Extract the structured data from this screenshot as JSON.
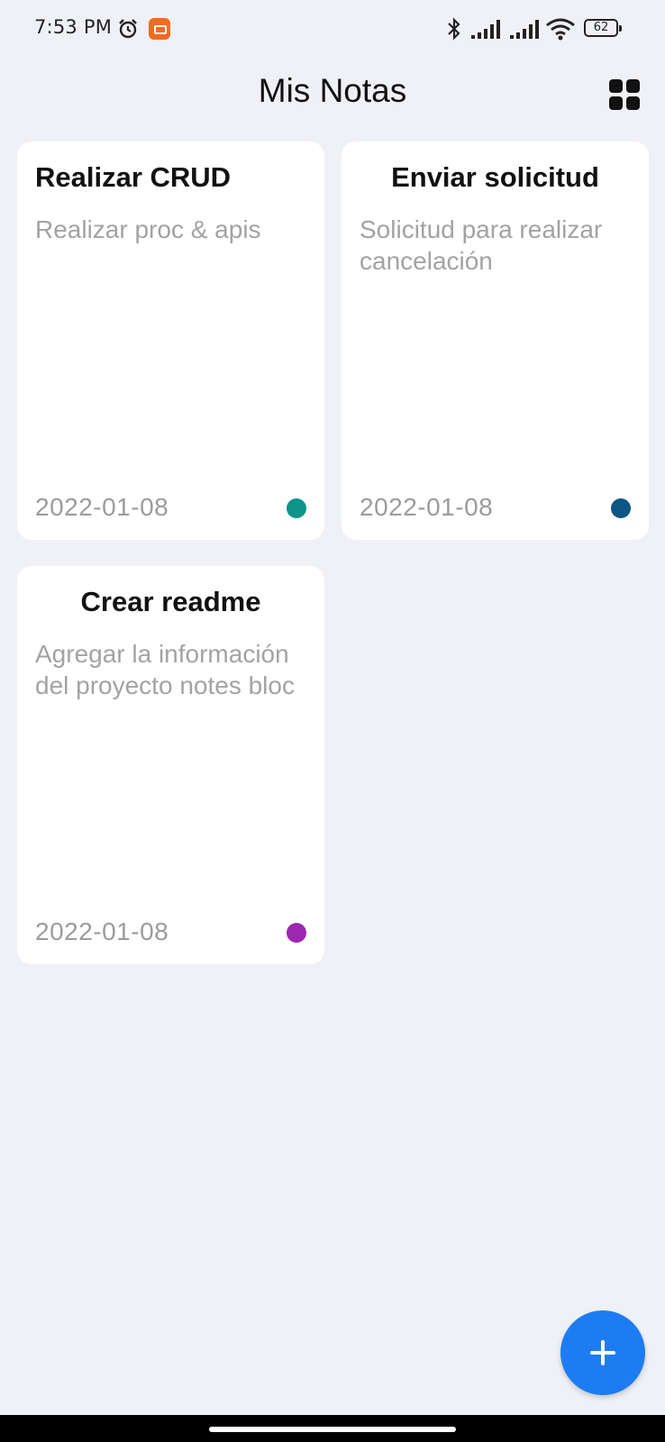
{
  "status_bar": {
    "time": "7:53 PM",
    "battery": "62",
    "icons": [
      "alarm-icon",
      "mi-app-icon",
      "bluetooth-icon",
      "signal-icon",
      "signal-icon",
      "wifi-icon",
      "battery-icon"
    ]
  },
  "header": {
    "title": "Mis Notas",
    "view_toggle_icon": "grid-view-icon"
  },
  "notes": [
    {
      "title": "Realizar CRUD",
      "body": "Realizar proc & apis",
      "date": "2022-01-08",
      "color": "#0e9488"
    },
    {
      "title": "Enviar solicitud",
      "body": "Solicitud para realizar cancelación",
      "date": "2022-01-08",
      "color": "#0c5684"
    },
    {
      "title": "Crear readme",
      "body": "Agregar la información del proyecto notes bloc",
      "date": "2022-01-08",
      "color": "#9c27b0"
    }
  ],
  "fab": {
    "icon": "plus-icon",
    "color": "#1e7cf2"
  }
}
